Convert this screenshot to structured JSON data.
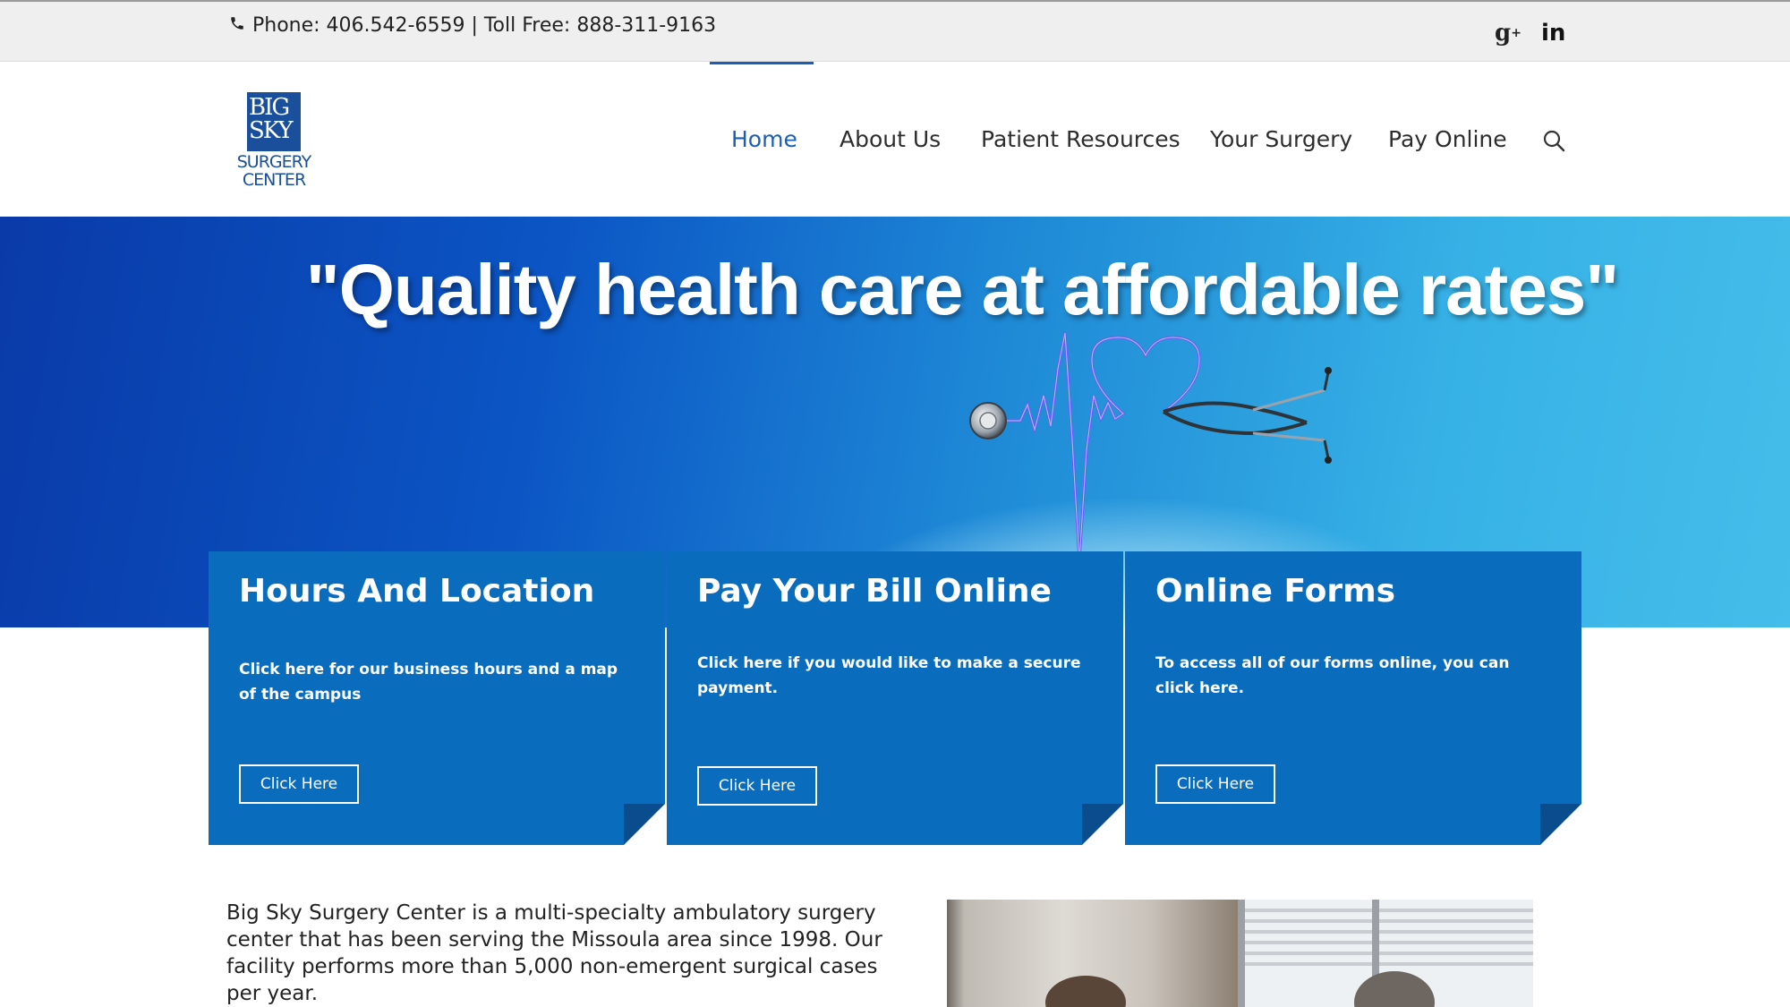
{
  "topbar": {
    "contact": "Phone: 406.542-6559 | Toll Free: 888-311-9163",
    "icons": {
      "phone": "phone-icon",
      "gplus": "google-plus-icon",
      "linkedin": "linkedin-icon"
    },
    "gplus_label": "g",
    "gplus_sup": "+",
    "linkedin_label": "in"
  },
  "logo": {
    "line1": "BIG",
    "line2": "SKY",
    "line3": "SURGERY",
    "line4": "CENTER"
  },
  "nav": {
    "items": [
      {
        "label": "Home",
        "active": true
      },
      {
        "label": "About Us",
        "active": false
      },
      {
        "label": "Patient Resources",
        "active": false
      },
      {
        "label": "Your Surgery",
        "active": false
      },
      {
        "label": "Pay Online",
        "active": false
      }
    ],
    "search_icon": "search-icon",
    "accent": "#1a5fb4"
  },
  "hero": {
    "title": "\"Quality health care at affordable rates\""
  },
  "cards": [
    {
      "title": "Hours And Location",
      "text": "Click here for our business hours and a map of the campus",
      "button": "Click Here"
    },
    {
      "title": "Pay Your Bill Online",
      "text": "Click here if you would like to make a secure payment.",
      "button": "Click Here"
    },
    {
      "title": "Online Forms",
      "text": "To access all of our forms online, you can click here.",
      "button": "Click Here"
    }
  ],
  "intro": {
    "text": "Big Sky Surgery Center is a multi-specialty ambulatory surgery center that has been serving the Missoula area since 1998. Our facility performs more than 5,000 non-emergent surgical cases per year."
  },
  "colors": {
    "card_blue": "#0a6cbd",
    "hero_dark": "#0a3aa8",
    "hero_light": "#45bdea"
  }
}
